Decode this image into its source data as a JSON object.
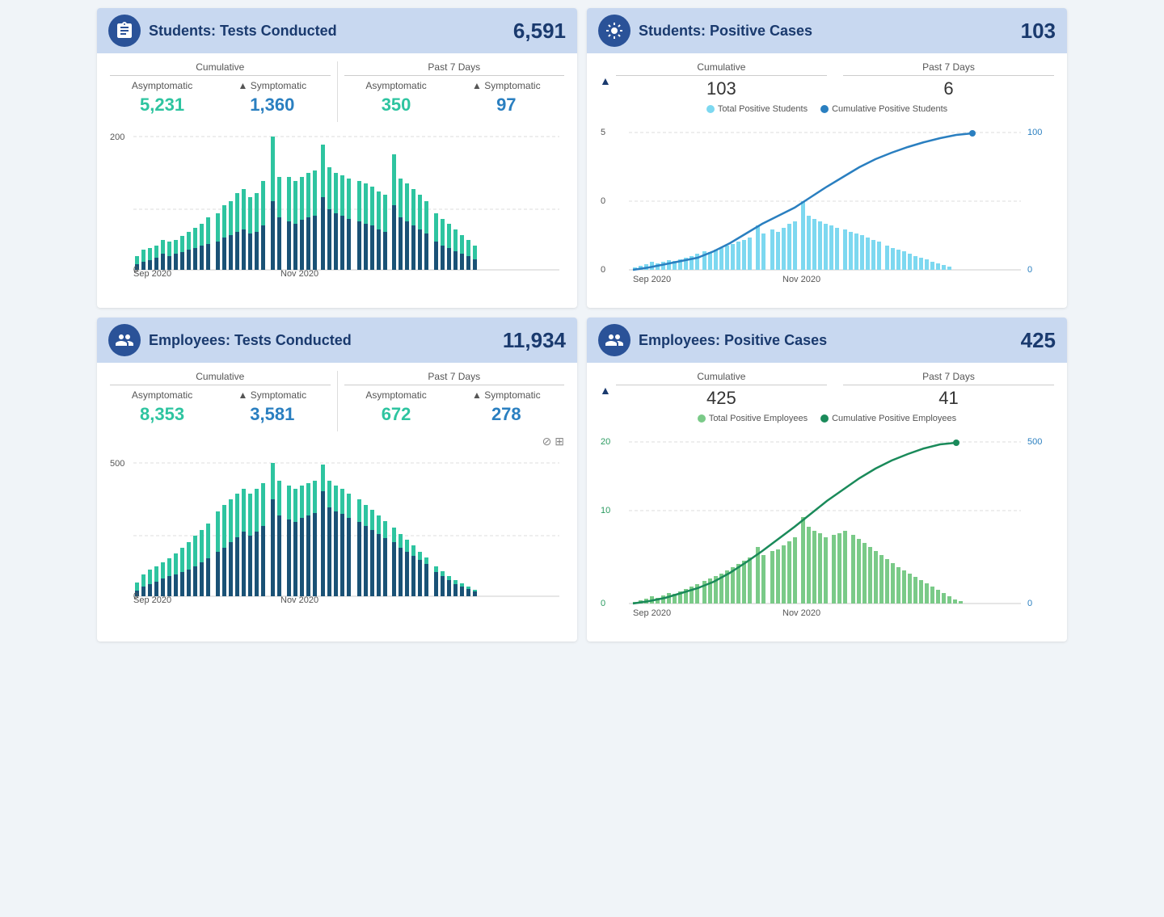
{
  "students_tests": {
    "title": "Students: Tests Conducted",
    "total": "6,591",
    "cumulative_label": "Cumulative",
    "past7_label": "Past 7 Days",
    "asymptomatic_label": "Asymptomatic",
    "symptomatic_label": "Symptomatic",
    "cum_asymptomatic": "5,231",
    "cum_symptomatic": "1,360",
    "p7_asymptomatic": "350",
    "p7_symptomatic": "97",
    "x_left": "Sep 2020",
    "x_right": "Nov 2020",
    "y_top": "200",
    "y_bottom": "0"
  },
  "students_positive": {
    "title": "Students: Positive Cases",
    "total": "103",
    "cumulative_label": "Cumulative",
    "past7_label": "Past 7 Days",
    "cumulative_value": "103",
    "past7_value": "6",
    "legend_light": "Total Positive Students",
    "legend_dark": "Cumulative Positive Students",
    "x_left": "Sep 2020",
    "x_right": "Nov 2020",
    "y_left_top": "5",
    "y_left_bottom": "0",
    "y_right_top": "100",
    "y_right_bottom": "0"
  },
  "employees_tests": {
    "title": "Employees: Tests Conducted",
    "total": "11,934",
    "cumulative_label": "Cumulative",
    "past7_label": "Past 7 Days",
    "asymptomatic_label": "Asymptomatic",
    "symptomatic_label": "Symptomatic",
    "cum_asymptomatic": "8,353",
    "cum_symptomatic": "3,581",
    "p7_asymptomatic": "672",
    "p7_symptomatic": "278",
    "x_left": "Sep 2020",
    "x_right": "Nov 2020",
    "y_top": "500",
    "y_bottom": "0"
  },
  "employees_positive": {
    "title": "Employees: Positive Cases",
    "total": "425",
    "cumulative_label": "Cumulative",
    "past7_label": "Past 7 Days",
    "cumulative_value": "425",
    "past7_value": "41",
    "legend_light": "Total Positive Employees",
    "legend_dark": "Cumulative Positive Employees",
    "x_left": "Sep 2020",
    "x_right": "Nov 2020",
    "y_left_top": "20",
    "y_left_bottom": "0",
    "y_right_top": "500",
    "y_right_bottom": "0"
  }
}
